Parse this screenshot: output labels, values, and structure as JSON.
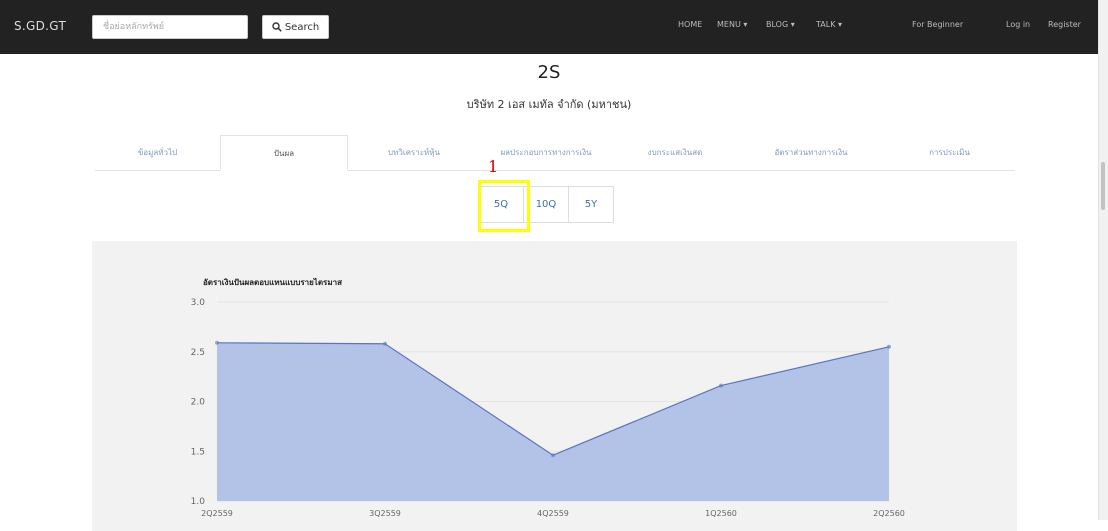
{
  "navbar": {
    "brand": "S.GD.GT",
    "search_placeholder": "ชื่อย่อหลักทรัพย์",
    "search_label": "Search",
    "items": [
      "HOME",
      "MENU ▾",
      "BLOG ▾",
      "TALK ▾",
      "For Beginner",
      "Log in",
      "Register"
    ]
  },
  "header": {
    "title": "2S",
    "subtitle": "บริษัท 2 เอส เมทัล จำกัด (มหาชน)"
  },
  "tabs": [
    "ข้อมูลทั่วไป",
    "ปันผล",
    "บทวิเคราะห์หุ้น",
    "ผลประกอบการทางการเงิน",
    "งบกระแสเงินสด",
    "อัตราส่วนทางการเงิน",
    "การประเมิน"
  ],
  "active_tab_index": 1,
  "period_buttons": [
    "5Q",
    "10Q",
    "5Y"
  ],
  "selected_period": "5Q",
  "annotation": {
    "number": "1",
    "color": "#ffff00"
  },
  "chart_data": {
    "type": "area",
    "title": "อัตราเงินปันผลตอบแทนแบบรายไตรมาส",
    "categories": [
      "2Q2559",
      "3Q2559",
      "4Q2559",
      "1Q2560",
      "2Q2560"
    ],
    "values": [
      2.59,
      2.58,
      1.46,
      2.16,
      2.55
    ],
    "y_ticks": [
      "1.0",
      "1.5",
      "2.0",
      "2.5",
      "3.0"
    ],
    "ylim": [
      1.0,
      3.0
    ],
    "fill_color": "#b3c3e8",
    "line_color": "#5a74c4",
    "grid": true
  }
}
